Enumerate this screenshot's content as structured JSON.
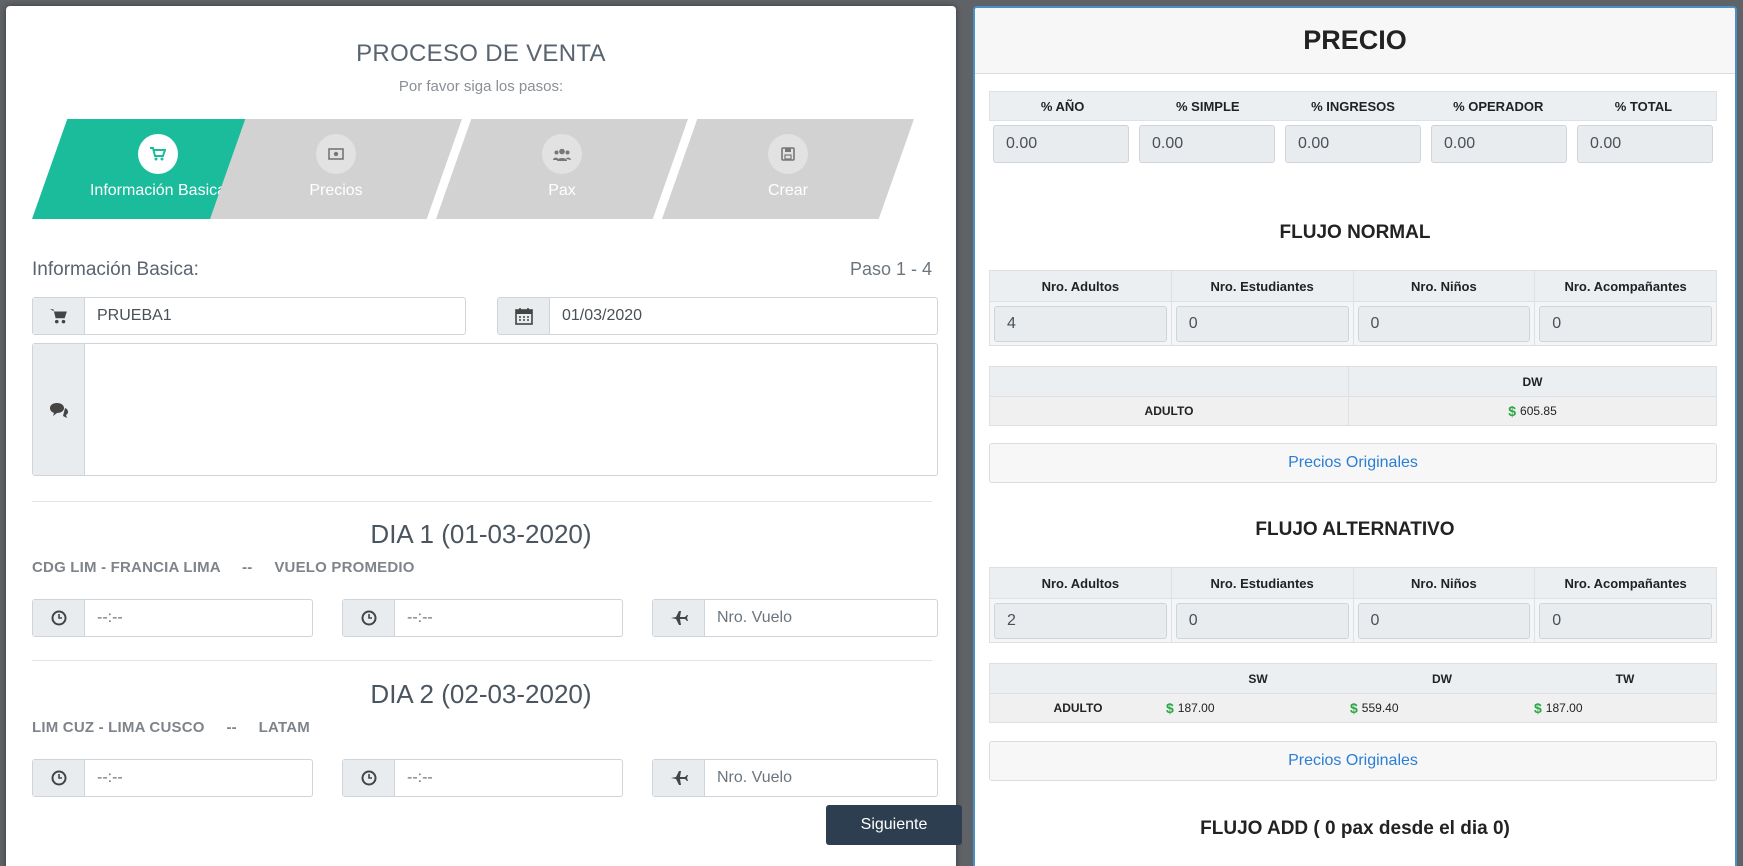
{
  "left": {
    "title": "PROCESO DE VENTA",
    "subtitle": "Por favor siga los pasos:",
    "steps": [
      {
        "label": "Información Basica",
        "icon": "cart-icon"
      },
      {
        "label": "Precios",
        "icon": "money-icon"
      },
      {
        "label": "Pax",
        "icon": "users-icon"
      },
      {
        "label": "Crear",
        "icon": "save-icon"
      }
    ],
    "section_title": "Información Basica:",
    "paso": "Paso 1 - 4",
    "nombre": "PRUEBA1",
    "fecha": "01/03/2020",
    "comentario": "",
    "dias": [
      {
        "title": "DIA 1 (01-03-2020)",
        "route": "CDG LIM - FRANCIA LIMA",
        "sep": "--",
        "carrier": "VUELO PROMEDIO",
        "hora1": "--:--",
        "hora2": "--:--",
        "vuelo_placeholder": "Nro. Vuelo"
      },
      {
        "title": "DIA 2 (02-03-2020)",
        "route": "LIM CUZ - LIMA CUSCO",
        "sep": "--",
        "carrier": "LATAM",
        "hora1": "--:--",
        "hora2": "--:--",
        "vuelo_placeholder": "Nro. Vuelo"
      }
    ],
    "next_label": "Siguiente"
  },
  "right": {
    "title": "PRECIO",
    "pct_headers": [
      "% AÑO",
      "% SIMPLE",
      "% INGRESOS",
      "% OPERADOR",
      "% TOTAL"
    ],
    "pct_values": [
      "0.00",
      "0.00",
      "0.00",
      "0.00",
      "0.00"
    ],
    "nro_headers": [
      "Nro. Adultos",
      "Nro. Estudiantes",
      "Nro. Niños",
      "Nro. Acompañantes"
    ],
    "normal": {
      "title": "FLUJO NORMAL",
      "nro_values": [
        "4",
        "0",
        "0",
        "0"
      ],
      "price_header": "DW",
      "row_label": "ADULTO",
      "price": "605.85",
      "btn": "Precios Originales"
    },
    "alt": {
      "title": "FLUJO ALTERNATIVO",
      "nro_values": [
        "2",
        "0",
        "0",
        "0"
      ],
      "price_headers": [
        "SW",
        "DW",
        "TW"
      ],
      "row_label": "ADULTO",
      "prices": [
        "187.00",
        "559.40",
        "187.00"
      ],
      "btn": "Precios Originales"
    },
    "add_title": "FLUJO ADD ( 0 pax desde el dia 0)",
    "currency": "$"
  }
}
